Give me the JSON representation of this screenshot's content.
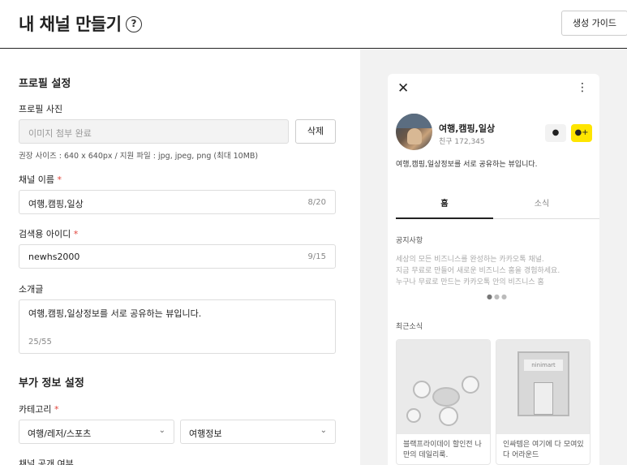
{
  "header": {
    "title": "내 채널 만들기",
    "help_icon": "?",
    "guide_button": "생성 가이드"
  },
  "profile": {
    "section_title": "프로필 설정",
    "photo_label": "프로필 사진",
    "photo_status": "이미지 첨부 완료",
    "delete_button": "삭제",
    "photo_hint": "권장 사이즈 : 640 x 640px / 지원 파일 : jpg, jpeg, png (최대 10MB)",
    "name_label": "채널 이름",
    "name_value": "여행,캠핑,일상",
    "name_count": "8/20",
    "search_id_label": "검색용 아이디",
    "search_id_value": "newhs2000",
    "search_id_count": "9/15",
    "intro_label": "소개글",
    "intro_value": "여행,캠핑,일상정보를 서로 공유하는 뷰입니다.",
    "intro_count": "25/55",
    "required_mark": "*"
  },
  "extra": {
    "section_title": "부가 정보 설정",
    "category_label": "카테고리",
    "category_main": "여행/레저/스포츠",
    "category_sub": "여행정보",
    "visibility_label": "채널 공개 여부"
  },
  "preview": {
    "close_icon": "✕",
    "more_icon": "⋮",
    "channel_name": "여행,캠핑,일상",
    "friends": "친구 172,345",
    "chat_icon": "●",
    "add_icon": "●+",
    "description": "여행,캠핑,일상정보를 서로 공유하는 뷰입니다.",
    "tabs": [
      "홈",
      "소식"
    ],
    "notice_title": "공지사항",
    "notice_lines": [
      "세상의 모든 비즈니스를 완성하는 카카오톡 채널.",
      "지금 무료로 만들어 새로운 비즈니스 홈을 경험하세요.",
      "누구나 무료로 만드는 카카오톡 안의 비즈니스 홈"
    ],
    "recent_title": "최근소식",
    "cards": [
      {
        "text": "블랙프라이데이 할인전 나만의 데일리룩."
      },
      {
        "text": "인싸템은 여기에 다 모여있다 어라운드",
        "sign": "ninimart"
      }
    ]
  },
  "colors": {
    "accent_yellow": "#fee500",
    "required_red": "#e1433a",
    "preview_bg": "#f2f2f2"
  }
}
